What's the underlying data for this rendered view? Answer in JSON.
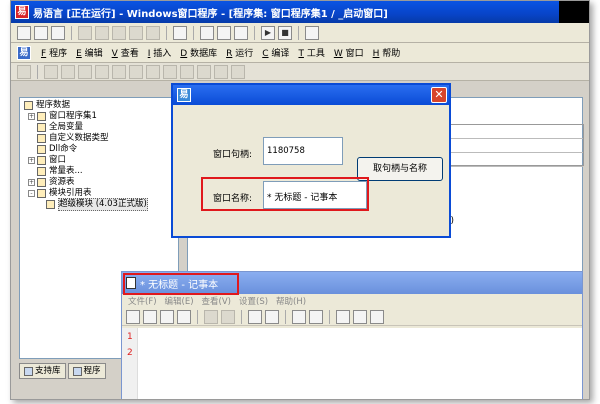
{
  "window": {
    "title": "易语言 [正在运行] - Windows窗口程序 - [程序集: 窗口程序集1 / _启动窗口]"
  },
  "menu": [
    {
      "key": "F",
      "label": "程序"
    },
    {
      "key": "E",
      "label": "编辑"
    },
    {
      "key": "V",
      "label": "查看"
    },
    {
      "key": "I",
      "label": "插入"
    },
    {
      "key": "D",
      "label": "数据库"
    },
    {
      "key": "R",
      "label": "运行"
    },
    {
      "key": "C",
      "label": "编译"
    },
    {
      "key": "T",
      "label": "工具"
    },
    {
      "key": "W",
      "label": "窗口"
    },
    {
      "key": "H",
      "label": "帮助"
    }
  ],
  "tree": {
    "root": "程序数据",
    "items": [
      "窗口程序集1",
      "全局变量",
      "自定义数据类型",
      "Dll命令",
      "窗口",
      "常量表...",
      "资源表",
      "模块引用表",
      "超级模块 (4.03正式版)"
    ]
  },
  "bottom_tabs": [
    "支持库",
    "程序"
  ],
  "code_snippet": "\" ))",
  "dialog": {
    "handle_label": "窗口句柄:",
    "handle_value": "1180758",
    "get_button": "取句柄与名称",
    "name_label": "窗口名称:",
    "name_value": "* 无标题 - 记事本"
  },
  "notepad": {
    "title": "* 无标题 - 记事本",
    "menu": [
      "文件(F)",
      "编辑(E)",
      "查看(V)",
      "设置(S)",
      "帮助(H)"
    ],
    "lines": [
      "1",
      "2"
    ]
  },
  "colors": {
    "accent": "#0a4bd6",
    "highlight": "#e0181c"
  }
}
